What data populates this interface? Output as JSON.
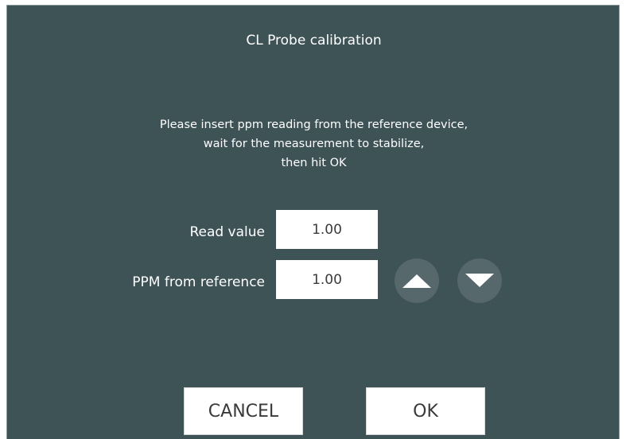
{
  "dialog": {
    "title": "CL Probe calibration",
    "instructions": [
      "Please insert ppm reading from the reference device,",
      "wait for the measurement to stabilize,",
      "then hit OK"
    ]
  },
  "fields": {
    "read_value": {
      "label": "Read value",
      "value": "1.00"
    },
    "ppm_reference": {
      "label": "PPM from reference",
      "value": "1.00"
    }
  },
  "stepper": {
    "up_icon": "triangle-up-icon",
    "down_icon": "triangle-down-icon"
  },
  "buttons": {
    "cancel": "CANCEL",
    "ok": "OK"
  },
  "colors": {
    "background": "#3e5356",
    "stepper": "#56686b",
    "text": "#ffffff"
  }
}
